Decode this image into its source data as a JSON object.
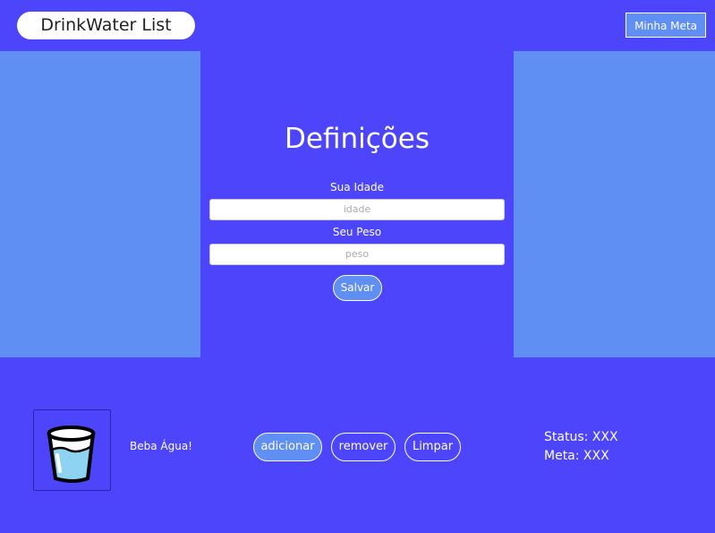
{
  "header": {
    "logo": "DrinkWater List",
    "goal_button": "Minha Meta"
  },
  "settings": {
    "title": "Definições",
    "age_label": "Sua Idade",
    "age_placeholder": "idade",
    "weight_label": "Seu Peso",
    "weight_placeholder": "peso",
    "save_button": "Salvar"
  },
  "footer": {
    "drink_text": "Beba Água!",
    "add_button": "adicionar",
    "remove_button": "remover",
    "clear_button": "Limpar",
    "status": "Status: XXX",
    "goal": "Meta: XXX"
  },
  "colors": {
    "primary": "#4d45fb",
    "accent": "#5f8ff2"
  },
  "icons": {
    "cup": "water-glass-icon"
  }
}
